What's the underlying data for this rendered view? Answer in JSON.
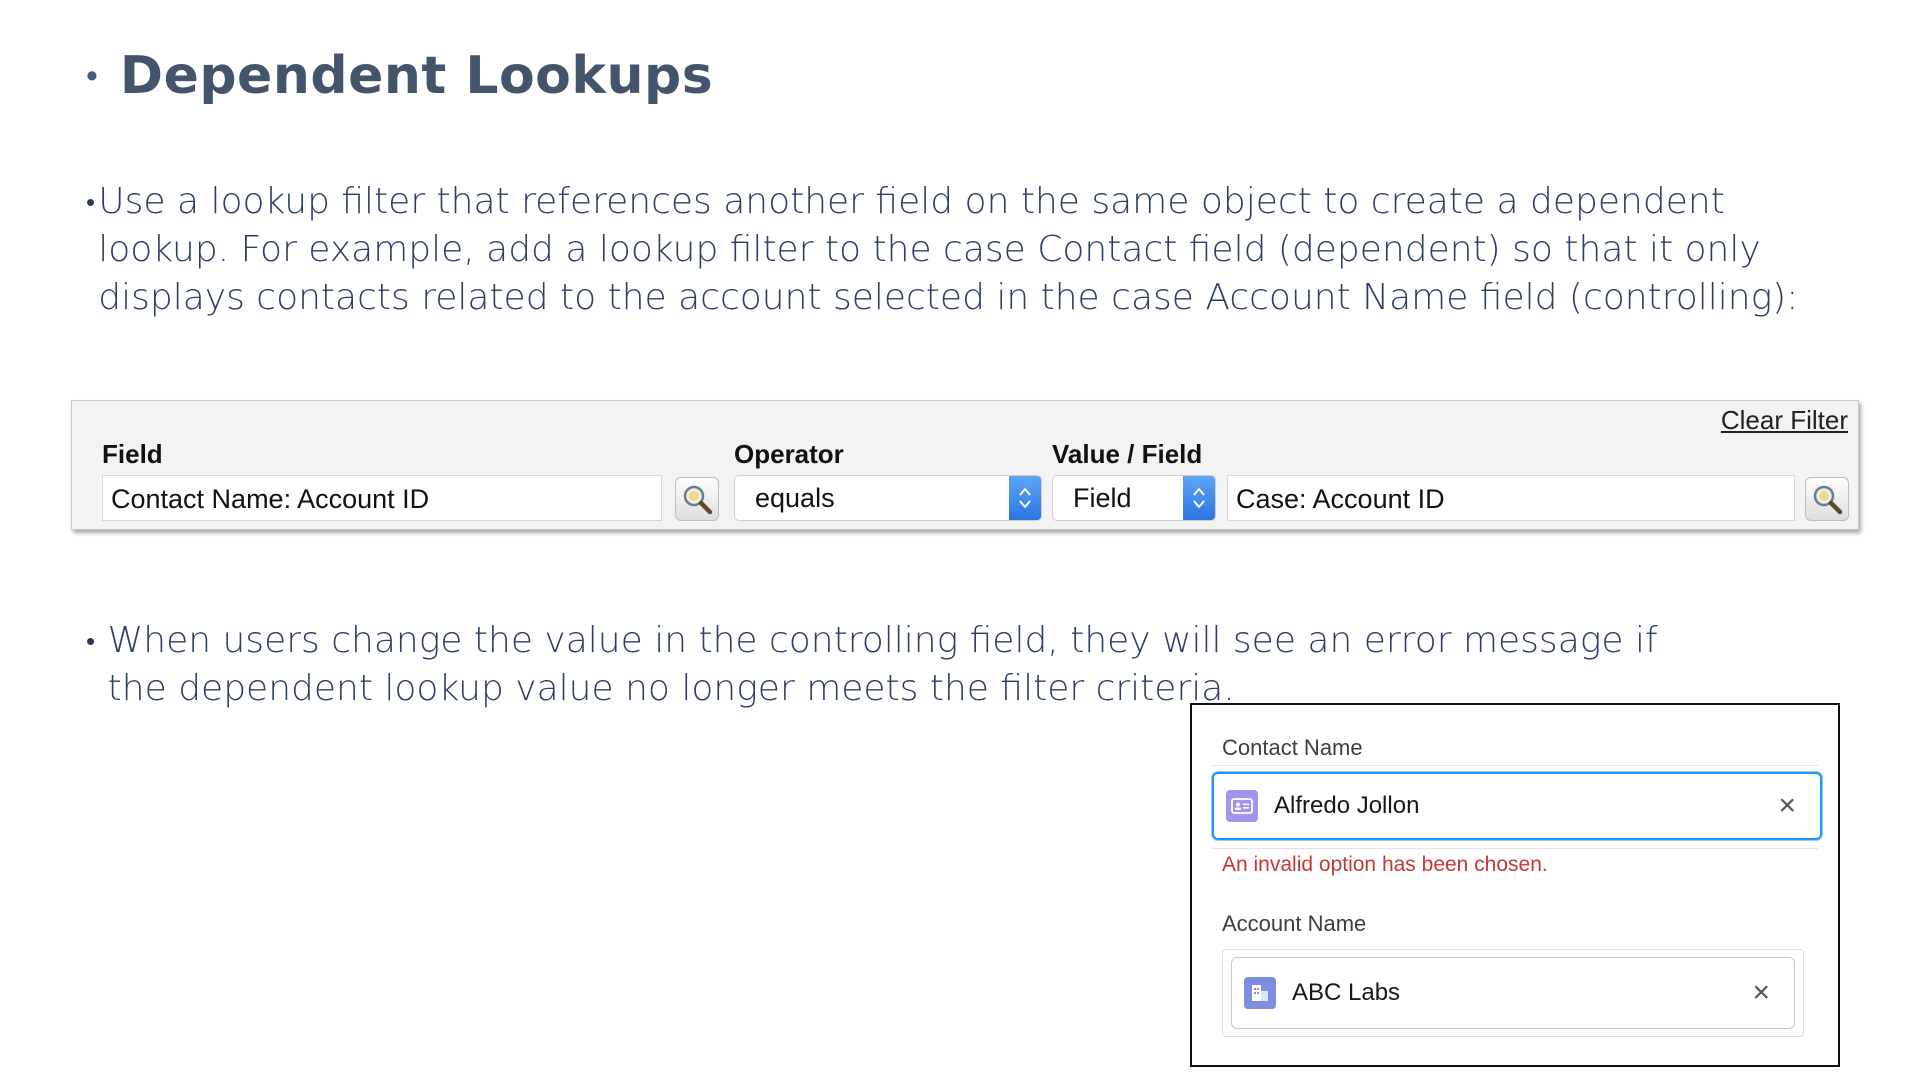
{
  "heading": {
    "bullet": "•",
    "title": "Dependent Lookups"
  },
  "paragraphs": [
    {
      "bullet": "•",
      "text": "Use a lookup filter that references another field on the same object to create a dependent lookup. For example, add a lookup filter to the case Contact field (dependent) so that it only displays contacts related to the account selected in the case Account Name field (controlling):"
    },
    {
      "bullet": "•",
      "text": "When users change the value in the controlling field, they will see an error message if the dependent lookup value no longer meets the filter criteria."
    }
  ],
  "filter": {
    "clear_filter": "Clear Filter",
    "field_label": "Field",
    "operator_label": "Operator",
    "value_label": "Value / Field",
    "field_value": "Contact Name: Account ID",
    "operator_value": "equals",
    "value_type": "Field",
    "value_field": "Case: Account ID",
    "lookup_icon": "magnifier-icon",
    "select_arrow_color": "#2a74e3"
  },
  "card": {
    "contact_label": "Contact Name",
    "contact_value": "Alfredo Jollon",
    "contact_icon": "contact-card-icon",
    "error": "An invalid option has been chosen.",
    "error_color": "#c23934",
    "account_label": "Account Name",
    "account_value": "ABC Labs",
    "account_icon": "account-building-icon",
    "clear_icon": "×"
  }
}
